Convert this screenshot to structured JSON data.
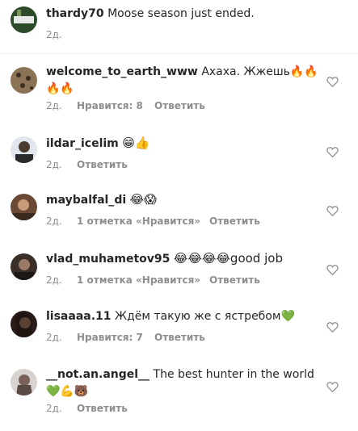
{
  "comments": [
    {
      "username": "thardy70",
      "text": "Moose season just ended.",
      "time": "2д.",
      "likes": "",
      "reply": "",
      "heart": false
    },
    {
      "username": "welcome_to_earth_www",
      "text": "Ахаха. Жжешь🔥🔥",
      "text_cont": "🔥🔥",
      "time": "2д.",
      "likes": "Нравится: 8",
      "reply": "Ответить",
      "heart": true
    },
    {
      "username": "ildar_icelim",
      "text": "😁👍",
      "time": "2д.",
      "likes": "",
      "reply": "Ответить",
      "heart": true
    },
    {
      "username": "maybalfal_di",
      "text": "😂😱",
      "time": "2д.",
      "likes": "1 отметка «Нравится»",
      "reply": "Ответить",
      "heart": true
    },
    {
      "username": "vlad_muhametov95",
      "text": "😂😂😂😂good job",
      "time": "2д.",
      "likes": "1 отметка «Нравится»",
      "reply": "Ответить",
      "heart": true
    },
    {
      "username": "lisaaaa.11",
      "text": "Ждём такую же с ястребом💚",
      "time": "2д.",
      "likes": "Нравится: 7",
      "reply": "Ответить",
      "heart": true
    },
    {
      "username": "__not.an.angel__",
      "text": "The best hunter in the world",
      "text_cont": "💚💪🐻",
      "time": "2д.",
      "likes": "",
      "reply": "Ответить",
      "heart": true
    }
  ]
}
